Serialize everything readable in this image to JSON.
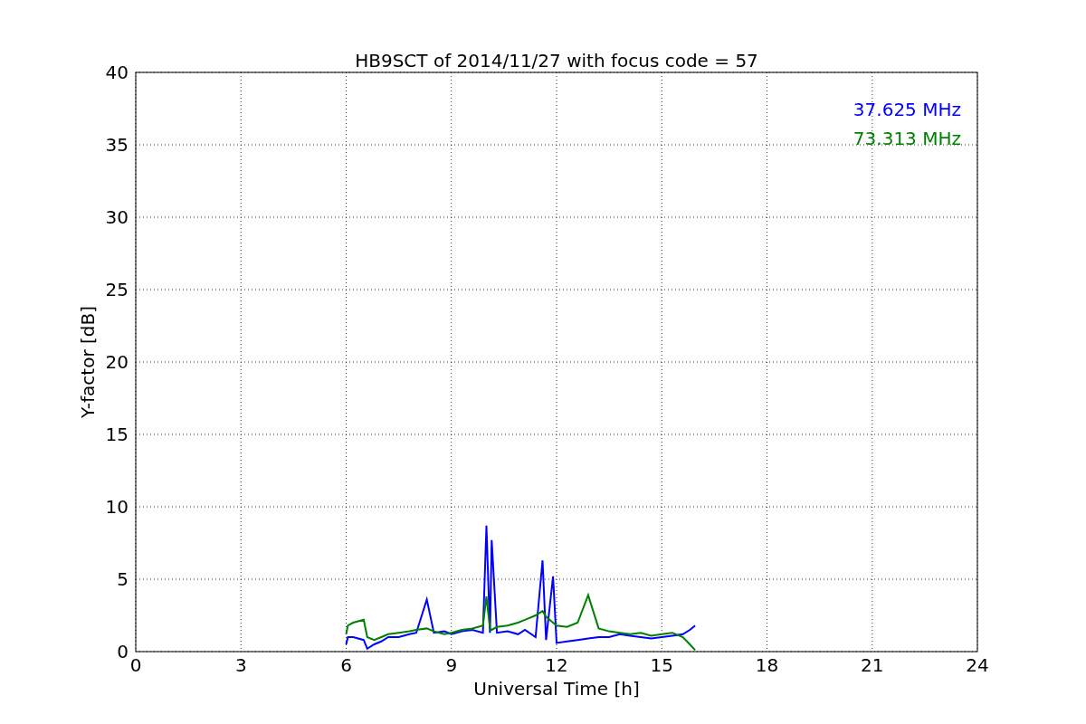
{
  "chart_data": {
    "type": "line",
    "title": "HB9SCT of 2014/11/27 with focus code = 57",
    "xlabel": "Universal Time [h]",
    "ylabel": "Y-factor [dB]",
    "x": [
      6.0,
      6.05,
      6.2,
      6.5,
      6.6,
      6.8,
      7.0,
      7.2,
      7.5,
      7.8,
      8.0,
      8.3,
      8.5,
      8.8,
      9.0,
      9.3,
      9.6,
      9.9,
      10.0,
      10.1,
      10.15,
      10.3,
      10.6,
      10.9,
      11.1,
      11.4,
      11.6,
      11.7,
      11.9,
      12.0,
      12.3,
      12.6,
      12.9,
      13.2,
      13.5,
      13.8,
      14.1,
      14.4,
      14.7,
      15.0,
      15.3,
      15.6,
      15.8,
      15.95
    ],
    "series": [
      {
        "name": "37.625 MHz",
        "color": "#0000ff",
        "values": [
          0.5,
          1.0,
          1.0,
          0.8,
          0.2,
          0.5,
          0.7,
          1.0,
          1.0,
          1.2,
          1.3,
          3.6,
          1.3,
          1.4,
          1.2,
          1.4,
          1.5,
          1.3,
          8.7,
          1.3,
          7.7,
          1.3,
          1.4,
          1.2,
          1.5,
          1.0,
          6.3,
          0.8,
          5.2,
          0.6,
          0.7,
          0.8,
          0.9,
          1.0,
          1.0,
          1.2,
          1.1,
          1.0,
          0.9,
          1.0,
          1.1,
          1.2,
          1.5,
          1.8
        ]
      },
      {
        "name": "73.313 MHz",
        "color": "#008000",
        "values": [
          1.2,
          1.8,
          2.0,
          2.2,
          1.0,
          0.8,
          1.0,
          1.2,
          1.3,
          1.4,
          1.5,
          1.6,
          1.4,
          1.2,
          1.3,
          1.5,
          1.6,
          1.8,
          3.8,
          1.6,
          1.5,
          1.7,
          1.8,
          2.0,
          2.2,
          2.5,
          2.8,
          2.4,
          2.0,
          1.8,
          1.7,
          2.0,
          3.9,
          1.6,
          1.4,
          1.3,
          1.2,
          1.3,
          1.1,
          1.2,
          1.3,
          1.0,
          0.5,
          0.1
        ]
      }
    ],
    "xlim": [
      0,
      24
    ],
    "ylim": [
      0,
      40
    ],
    "xticks": [
      0,
      3,
      6,
      9,
      12,
      15,
      18,
      21,
      24
    ],
    "yticks": [
      0,
      5,
      10,
      15,
      20,
      25,
      30,
      35,
      40
    ],
    "grid": true
  }
}
